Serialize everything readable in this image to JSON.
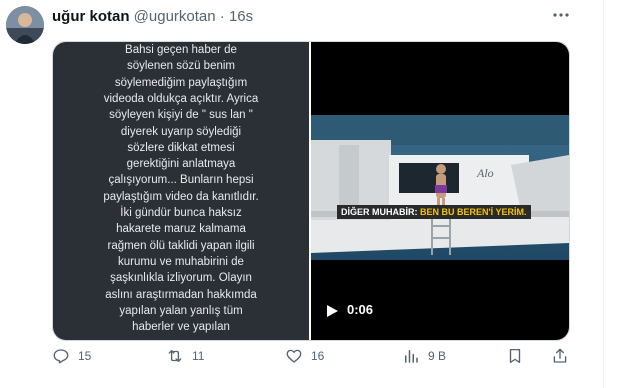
{
  "author": {
    "name": "uğur kotan",
    "handle": "@ugurkotan",
    "separator": "·",
    "age": "16s"
  },
  "note_lines": [
    "Bahsi geçen haber de",
    "söylenen sözü benim",
    "söylemediğim paylaştığım",
    "videoda oldukça açıktır.  Ayrica",
    "söyleyen kişiyi de \" sus lan \"",
    "diyerek uyarıp söylediği",
    "sözlere dikkat etmesi",
    "gerektiğini anlatmaya",
    "çalışıyorum... Bunların hepsi",
    "paylaştığım video da kanıtlıdır.",
    "İki gündür bunca haksız",
    "hakarete maruz kalmama",
    "rağmen  ölü taklidi yapan ilgili",
    "kurumu ve muhabirini de",
    "şaşkınlıkla izliyorum. Olayın",
    "aslını araştırmadan hakkımda",
    "yapılan yalan yanlış tüm",
    "haberler ve yapılan"
  ],
  "video": {
    "caption_speaker": "DİĞER MUHABİR: ",
    "caption_quote": "BEN BU BEREN'İ YERİM.",
    "duration": "0:06",
    "yacht_name": "Alo"
  },
  "actions": {
    "replies": "15",
    "reposts": "11",
    "likes": "16",
    "views": "9 B"
  },
  "colors": {
    "text_secondary": "#536471",
    "note_background": "#2b2f36",
    "caption_highlight": "#f5c400"
  }
}
